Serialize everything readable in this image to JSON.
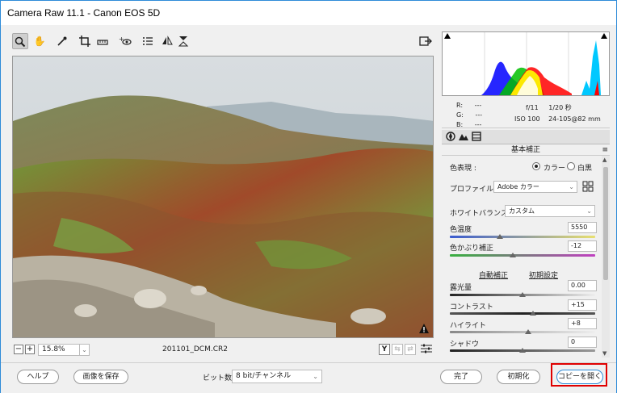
{
  "window": {
    "title": "Camera Raw 11.1  -  Canon EOS 5D"
  },
  "toolbar": {
    "tools": [
      "zoom-icon",
      "hand-icon",
      "eyedropper-icon",
      "crop-icon",
      "straighten-icon",
      "red-eye-icon",
      "list-icon",
      "flip-horizontal-icon",
      "flip-vertical-icon",
      "fullscreen-icon"
    ]
  },
  "info": {
    "r_label": "R:",
    "g_label": "G:",
    "b_label": "B:",
    "r": "---",
    "g": "---",
    "b": "---",
    "aperture": "f/11",
    "shutter": "1/20 秒",
    "iso": "ISO 100",
    "lens": "24-105@82 mm"
  },
  "status": {
    "zoom": "15.8%",
    "filename": "201101_DCM.CR2",
    "y_button": "Y"
  },
  "panel": {
    "title": "基本補正",
    "treatment_label": "色表現 :",
    "treatment_color": "カラー",
    "treatment_bw": "白黒",
    "profile_label": "プロファイル :",
    "profile_value": "Adobe カラー",
    "wb_label": "ホワイトバランス :",
    "wb_value": "カスタム",
    "temp_label": "色温度",
    "temp_value": "5550",
    "tint_label": "色かぶり補正",
    "tint_value": "-12",
    "auto_link": "自動補正",
    "default_link": "初期設定",
    "exposure_label": "露光量",
    "exposure_value": "0.00",
    "contrast_label": "コントラスト",
    "contrast_value": "+15",
    "highlights_label": "ハイライト",
    "highlights_value": "+8",
    "shadows_label": "シャドウ",
    "shadows_value": "0"
  },
  "footer": {
    "help": "ヘルプ",
    "save": "画像を保存",
    "bitdepth_label": "ビット数 :",
    "bitdepth_value": "8 bit/チャンネル",
    "done": "完了",
    "reset": "初期化",
    "open_copy": "コピーを開く"
  },
  "colors": {
    "accent": "#2e8bd8",
    "highlight": "#e00000"
  }
}
